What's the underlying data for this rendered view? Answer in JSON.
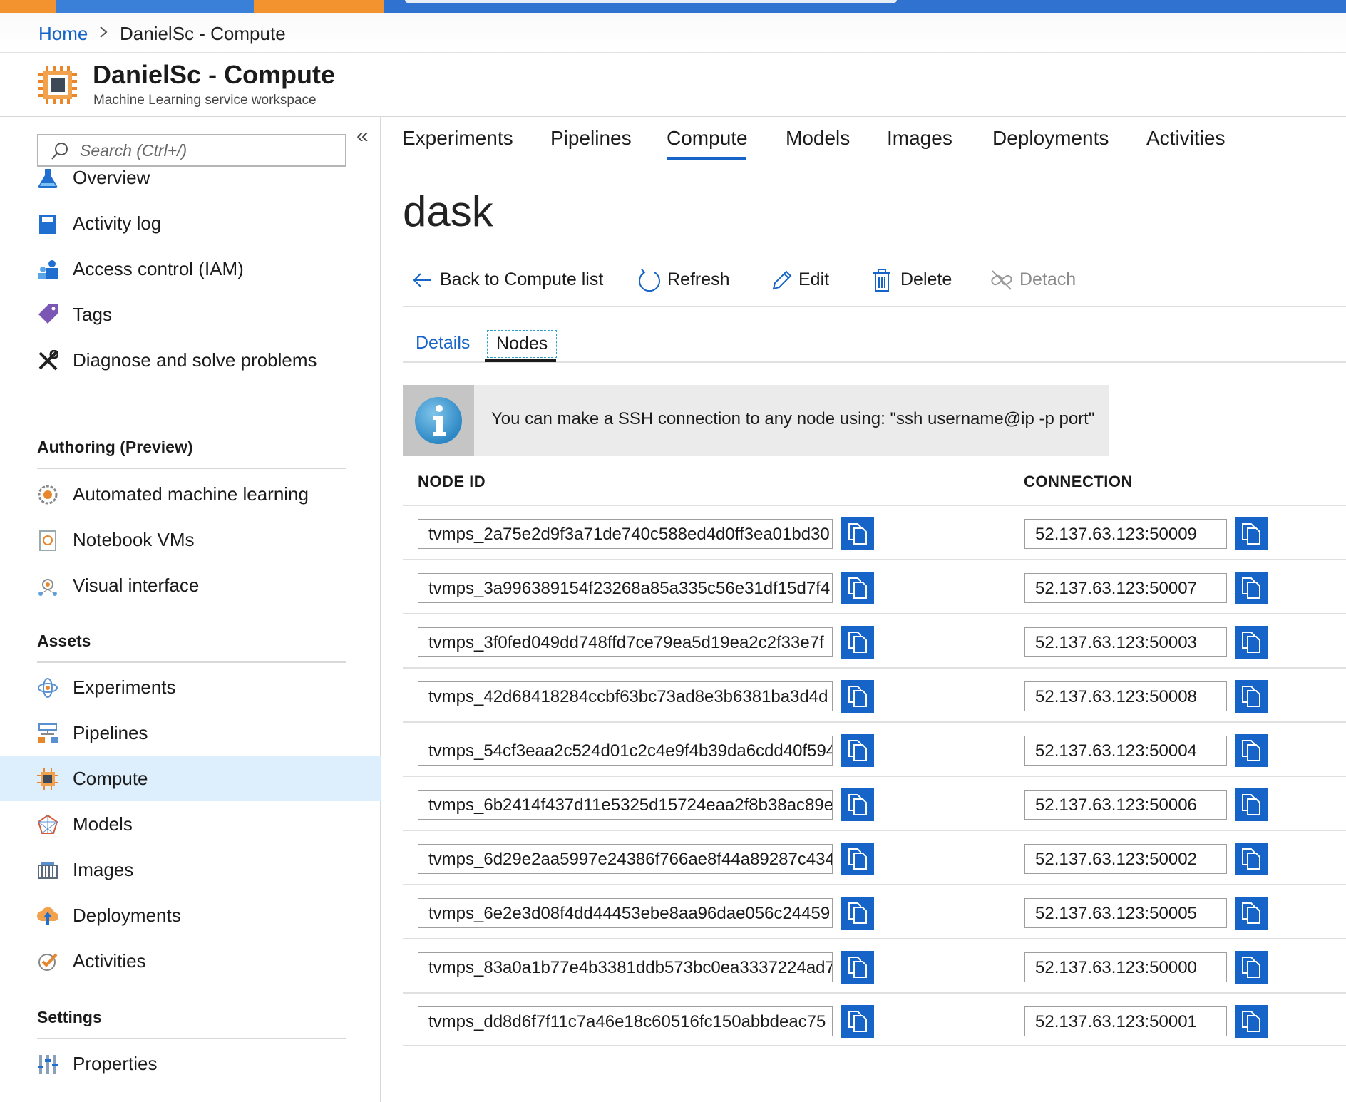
{
  "breadcrumb": {
    "home": "Home",
    "separator": ">",
    "current": "DanielSc - Compute"
  },
  "header": {
    "title": "DanielSc - Compute",
    "subtitle": "Machine Learning service workspace",
    "icon": "chip-icon"
  },
  "sidebar": {
    "collapse_label": "«",
    "search_placeholder": "Search (Ctrl+/)",
    "top_items": [
      {
        "label": "Overview",
        "icon": "flask-icon"
      },
      {
        "label": "Activity log",
        "icon": "activity-log-icon"
      },
      {
        "label": "Access control (IAM)",
        "icon": "people-icon"
      },
      {
        "label": "Tags",
        "icon": "tag-icon"
      },
      {
        "label": "Diagnose and solve problems",
        "icon": "tools-icon"
      }
    ],
    "authoring": {
      "title": "Authoring (Preview)",
      "items": [
        {
          "label": "Automated machine learning",
          "icon": "automl-icon"
        },
        {
          "label": "Notebook VMs",
          "icon": "notebook-icon"
        },
        {
          "label": "Visual interface",
          "icon": "visual-interface-icon"
        }
      ]
    },
    "assets": {
      "title": "Assets",
      "items": [
        {
          "label": "Experiments",
          "icon": "experiments-icon"
        },
        {
          "label": "Pipelines",
          "icon": "pipelines-icon"
        },
        {
          "label": "Compute",
          "icon": "compute-icon",
          "active": true
        },
        {
          "label": "Models",
          "icon": "models-icon"
        },
        {
          "label": "Images",
          "icon": "images-icon"
        },
        {
          "label": "Deployments",
          "icon": "deployments-icon"
        },
        {
          "label": "Activities",
          "icon": "activities-icon"
        }
      ]
    },
    "settings": {
      "title": "Settings",
      "items": [
        {
          "label": "Properties",
          "icon": "properties-icon"
        }
      ]
    }
  },
  "tabs": [
    "Experiments",
    "Pipelines",
    "Compute",
    "Models",
    "Images",
    "Deployments",
    "Activities"
  ],
  "active_tab": "Compute",
  "page_title": "dask",
  "toolbar": {
    "back": "Back to Compute list",
    "refresh": "Refresh",
    "edit": "Edit",
    "delete": "Delete",
    "detach": "Detach"
  },
  "subtabs": {
    "details": "Details",
    "nodes": "Nodes"
  },
  "info_message": "You can make a SSH connection to any node using: \"ssh username@ip -p port\"",
  "table": {
    "headers": {
      "node_id": "NODE ID",
      "connection": "CONNECTION"
    },
    "rows": [
      {
        "node_id": "tvmps_2a75e2d9f3a71de740c588ed4d0ff3ea01bd30",
        "connection": "52.137.63.123:50009"
      },
      {
        "node_id": "tvmps_3a996389154f23268a85a335c56e31df15d7f4",
        "connection": "52.137.63.123:50007"
      },
      {
        "node_id": "tvmps_3f0fed049dd748ffd7ce79ea5d19ea2c2f33e7f",
        "connection": "52.137.63.123:50003"
      },
      {
        "node_id": "tvmps_42d68418284ccbf63bc73ad8e3b6381ba3d4d",
        "connection": "52.137.63.123:50008"
      },
      {
        "node_id": "tvmps_54cf3eaa2c524d01c2c4e9f4b39da6cdd40f594",
        "connection": "52.137.63.123:50004"
      },
      {
        "node_id": "tvmps_6b2414f437d11e5325d15724eaa2f8b38ac89e",
        "connection": "52.137.63.123:50006"
      },
      {
        "node_id": "tvmps_6d29e2aa5997e24386f766ae8f44a89287c434",
        "connection": "52.137.63.123:50002"
      },
      {
        "node_id": "tvmps_6e2e3d08f4dd44453ebe8aa96dae056c24459",
        "connection": "52.137.63.123:50005"
      },
      {
        "node_id": "tvmps_83a0a1b77e4b3381ddb573bc0ea3337224ad7",
        "connection": "52.137.63.123:50000"
      },
      {
        "node_id": "tvmps_dd8d6f7f11c7a46e18c60516fc150abbdeac75",
        "connection": "52.137.63.123:50001"
      }
    ]
  },
  "colors": {
    "accent": "#1664c7",
    "active_nav_bg": "#ddeefc",
    "top_bar": "#2f72d0",
    "top_bar_orange": "#f2932f"
  }
}
